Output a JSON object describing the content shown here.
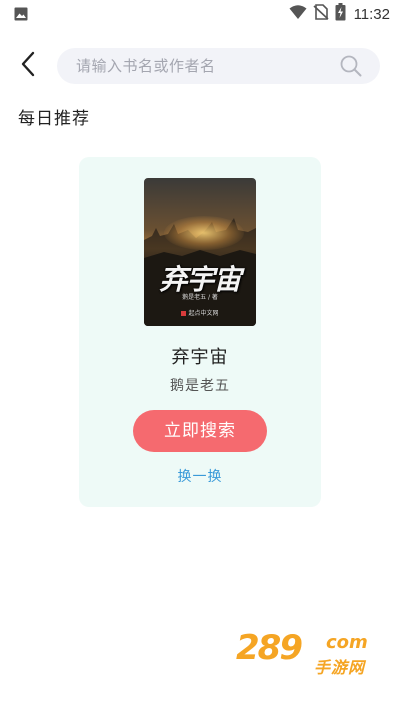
{
  "status_bar": {
    "time": "11:32",
    "icons": [
      "image-icon",
      "wifi-icon",
      "no-sim-icon",
      "battery-charging-icon"
    ]
  },
  "header": {
    "back_icon": "chevron-left-icon",
    "search": {
      "placeholder": "请输入书名或作者名",
      "icon": "search-icon"
    }
  },
  "section": {
    "title": "每日推荐"
  },
  "recommendation": {
    "cover": {
      "title": "弃宇宙",
      "author_line": "鹅是老五 / 著",
      "publisher": "起点中文网"
    },
    "book_title": "弃宇宙",
    "author": "鹅是老五",
    "search_button": "立即搜索",
    "refresh_link": "换一换"
  },
  "watermark": {
    "number": "289",
    "suffix": "com",
    "subtitle": "手游网"
  },
  "colors": {
    "card_bg": "#eefaf7",
    "button": "#f56a6f",
    "link": "#3a9ad9",
    "search_bg": "#f2f3f8",
    "watermark": "#f5a524"
  }
}
